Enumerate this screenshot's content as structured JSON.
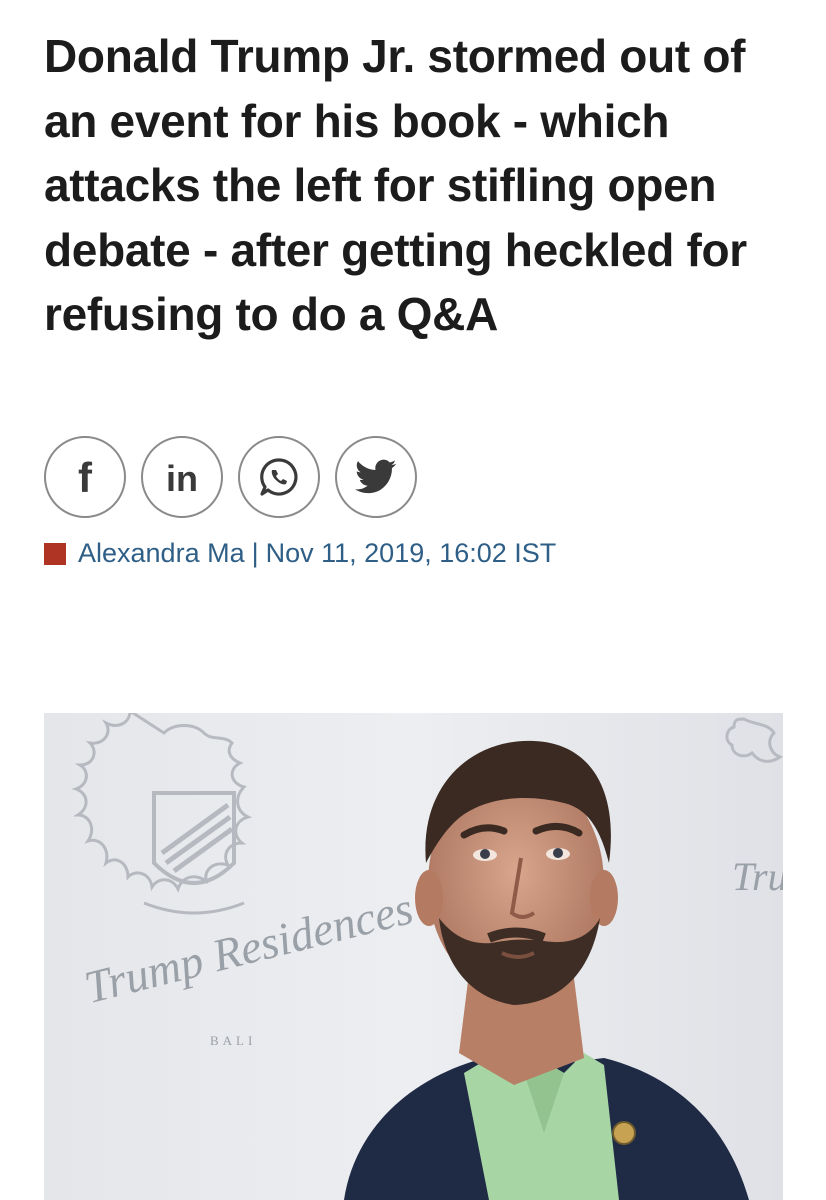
{
  "article": {
    "headline": "Donald Trump Jr. stormed out of an event for his book - which attacks the left for stifling open debate - after getting heckled for refusing to do a Q&A",
    "author": "Alexandra Ma",
    "separator": "|",
    "date": "Nov 11, 2019, 16:02 IST"
  },
  "share": [
    {
      "icon": "facebook-icon",
      "label": "f"
    },
    {
      "icon": "linkedin-icon",
      "label": "in"
    },
    {
      "icon": "whatsapp-icon"
    },
    {
      "icon": "twitter-icon"
    }
  ],
  "photo": {
    "watermark_main": "Trump Residences",
    "watermark_sub": "BALI",
    "watermark_right": "Tru"
  },
  "colors": {
    "headline": "#1c1c1c",
    "byline": "#2f5f86",
    "marker": "#b03424",
    "share_border": "#8a8a8a"
  }
}
